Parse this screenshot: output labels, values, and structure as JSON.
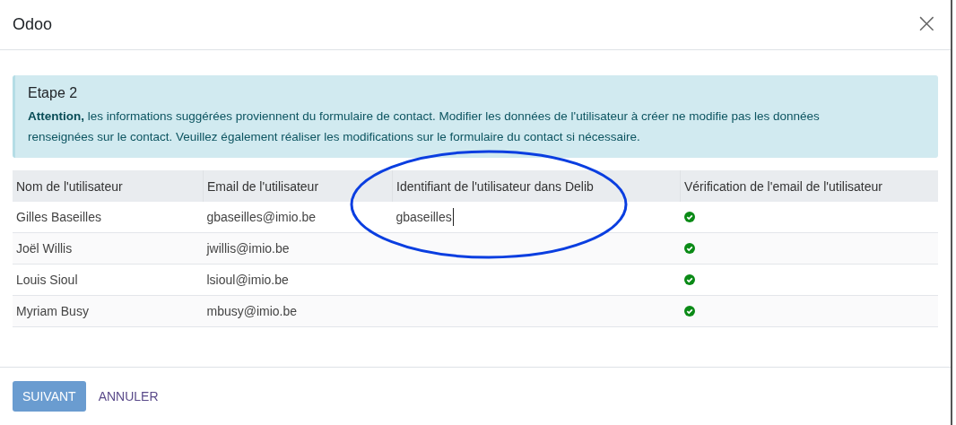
{
  "dialog": {
    "title": "Odoo",
    "close": "×"
  },
  "alert": {
    "title": "Etape 2",
    "text": "**Attention,** les informations suggérées proviennent du formulaire de contact. Modifier les données de l'utilisateur à créer ne modifie pas les données renseignées sur le contact. Veuillez également réaliser les modifications sur le formulaire du contact si nécessaire."
  },
  "table": {
    "columns": [
      "Nom de l'utilisateur",
      "Email de l'utilisateur",
      "Identifiant de l'utilisateur dans Delib",
      "Vérification de l'email de l'utilisateur"
    ],
    "rows": [
      {
        "name": "Gilles Baseilles",
        "email": "gbaseilles@imio.be",
        "identifier": "gbaseilles",
        "focused": true,
        "verified": true
      },
      {
        "name": "Joël Willis",
        "email": "jwillis@imio.be",
        "verified": true
      },
      {
        "name": "Louis Sioul",
        "email": "lsioul@imio.be",
        "verified": true
      },
      {
        "name": "Myriam Busy",
        "email": "mbusy@imio.be",
        "verified": true
      }
    ]
  },
  "buttons": [
    {
      "label": "SUIVANT",
      "kind": "primary"
    },
    {
      "label": "ANNULER",
      "kind": "link"
    }
  ],
  "annotation": {
    "kind": "ellipse"
  }
}
